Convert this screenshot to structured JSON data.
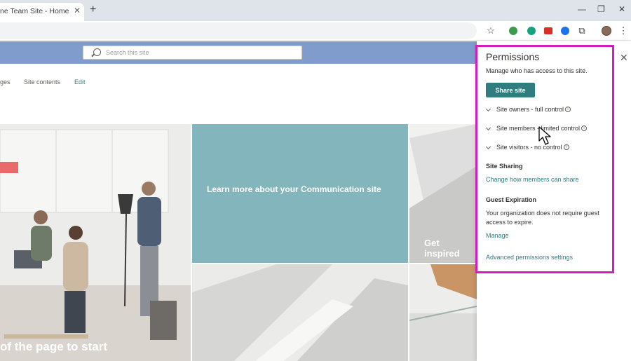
{
  "browser": {
    "tab_title": "ne Team Site - Home",
    "tab_close": "✕",
    "new_tab": "+",
    "window_controls": {
      "minimize": "—",
      "restore": "❐",
      "close": "✕"
    },
    "toolbar_icons": [
      "star-icon",
      "extension-green-icon",
      "extension-grammarly-icon",
      "extension-red-icon",
      "extension-blue-icon",
      "extensions-puzzle-icon",
      "profile-avatar",
      "more-menu-icon"
    ],
    "star": "☆",
    "puzzle": "⧉",
    "more": "⋮",
    "ext_colors": {
      "green": "#3c9c4e",
      "grammarly": "#15a37f",
      "red": "#d93025",
      "blue": "#1a73e8"
    }
  },
  "suitebar": {
    "search_placeholder": "Search this site"
  },
  "site_nav": {
    "items": [
      "ges",
      "Site contents",
      "Edit"
    ]
  },
  "hero": {
    "teal_tile_text": "Learn more about your Communication site",
    "bottom_left_text": "of the page to start",
    "right_tile_text": "Get inspired",
    "teal_color": "#82b6bc"
  },
  "permissions": {
    "title": "Permissions",
    "description": "Manage who has access to this site.",
    "share_button": "Share site",
    "groups": [
      {
        "label": "Site owners - full control"
      },
      {
        "label": "Site members - limited control"
      },
      {
        "label": "Site visitors - no control"
      }
    ],
    "info_glyph": "i",
    "site_sharing_heading": "Site Sharing",
    "site_sharing_link": "Change how members can share",
    "guest_heading": "Guest Expiration",
    "guest_text": "Your organization does not require guest access to expire.",
    "manage_link": "Manage",
    "advanced_link": "Advanced permissions settings",
    "close": "✕",
    "accent_color": "#2f7d7f",
    "highlight_color": "#d21fbc"
  }
}
